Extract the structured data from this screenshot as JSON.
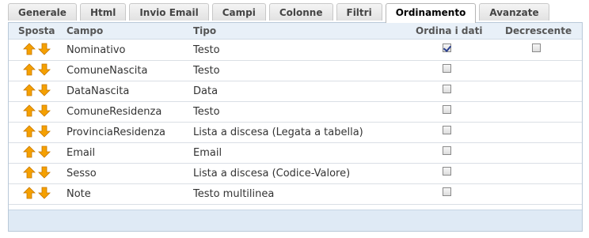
{
  "tabs": [
    {
      "label": "Generale"
    },
    {
      "label": "Html"
    },
    {
      "label": "Invio Email"
    },
    {
      "label": "Campi"
    },
    {
      "label": "Colonne"
    },
    {
      "label": "Filtri"
    },
    {
      "label": "Ordinamento",
      "active": true
    },
    {
      "label": "Avanzate"
    }
  ],
  "table": {
    "headers": {
      "sposta": "Sposta",
      "campo": "Campo",
      "tipo": "Tipo",
      "ordina": "Ordina i dati",
      "decrescente": "Decrescente"
    },
    "rows": [
      {
        "campo": "Nominativo",
        "tipo": "Testo",
        "ordina": true,
        "decrescente": false,
        "show_decrescente": true
      },
      {
        "campo": "ComuneNascita",
        "tipo": "Testo",
        "ordina": false,
        "show_decrescente": false
      },
      {
        "campo": "DataNascita",
        "tipo": "Data",
        "ordina": false,
        "show_decrescente": false
      },
      {
        "campo": "ComuneResidenza",
        "tipo": "Testo",
        "ordina": false,
        "show_decrescente": false
      },
      {
        "campo": "ProvinciaResidenza",
        "tipo": "Lista a discesa (Legata a tabella)",
        "ordina": false,
        "show_decrescente": false
      },
      {
        "campo": "Email",
        "tipo": "Email",
        "ordina": false,
        "show_decrescente": false
      },
      {
        "campo": "Sesso",
        "tipo": "Lista a discesa (Codice-Valore)",
        "ordina": false,
        "show_decrescente": false
      },
      {
        "campo": "Note",
        "tipo": "Testo multilinea",
        "ordina": false,
        "show_decrescente": false
      }
    ]
  },
  "icons": {
    "up": "arrow-up-icon",
    "down": "arrow-down-icon"
  },
  "colors": {
    "arrow": "#f5a000",
    "header_bg": "#e8f0f8",
    "footer_bg": "#dfeaf5"
  }
}
